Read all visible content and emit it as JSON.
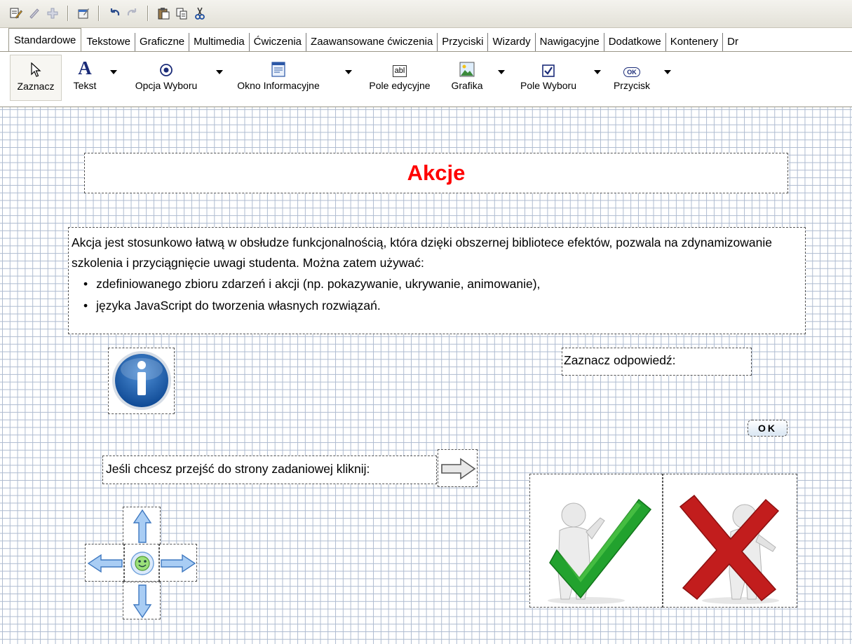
{
  "toolbar": {
    "icons": [
      "edit-page-icon",
      "edit-icon",
      "add-icon",
      "properties-icon",
      "undo-icon",
      "redo-icon",
      "paste-icon",
      "copy-icon",
      "cut-icon"
    ]
  },
  "tabs": [
    {
      "label": "Standardowe",
      "active": true
    },
    {
      "label": "Tekstowe"
    },
    {
      "label": "Graficzne"
    },
    {
      "label": "Multimedia"
    },
    {
      "label": "Ćwiczenia"
    },
    {
      "label": "Zaawansowane ćwiczenia"
    },
    {
      "label": "Przyciski"
    },
    {
      "label": "Wizardy"
    },
    {
      "label": "Nawigacyjne"
    },
    {
      "label": "Dodatkowe"
    },
    {
      "label": "Kontenery"
    },
    {
      "label": "Dr"
    }
  ],
  "ribbon": {
    "select": "Zaznacz",
    "text": "Tekst",
    "radio": "Opcja Wyboru",
    "info_window": "Okno Informacyjne",
    "edit_field": "Pole edycyjne",
    "graphic": "Grafika",
    "checkbox": "Pole Wyboru",
    "button": "Przycisk",
    "edit_field_icon_text": "abl",
    "button_icon_text": "OK"
  },
  "page": {
    "title": "Akcje",
    "title_color": "#ff0000",
    "intro": "Akcja jest stosunkowo łatwą w obsłudze funkcjonalnością, która dzięki obszernej bibliotece efektów, pozwala na zdynamizowanie szkolenia i przyciągnięcie uwagi studenta. Można zatem używać:",
    "bullets": [
      "zdefiniowanego zbioru zdarzeń i akcji (np. pokazywanie, ukrywanie, animowanie),",
      "języka JavaScript do tworzenia własnych rozwiązań."
    ],
    "answer_prompt": "Zaznacz odpowiedź:",
    "ok_label": "OK",
    "goto_text": "Jeśli chcesz przejść do strony zadaniowej kliknij:"
  }
}
